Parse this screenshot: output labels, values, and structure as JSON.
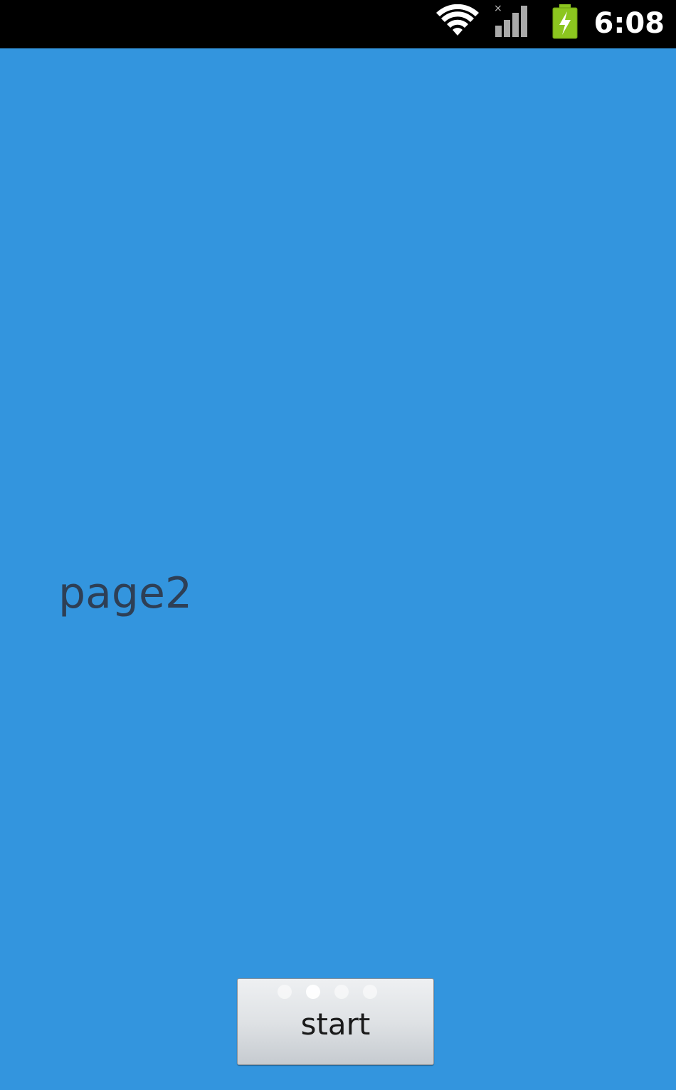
{
  "status_bar": {
    "time": "6:08",
    "icons": [
      "wifi-icon",
      "signal-icon",
      "battery-charging-icon"
    ],
    "background": "#000000"
  },
  "main": {
    "background": "#3395de",
    "page_label": "page2",
    "start_button_label": "start",
    "page_indicator": {
      "count": 4,
      "active_index": 1
    }
  }
}
